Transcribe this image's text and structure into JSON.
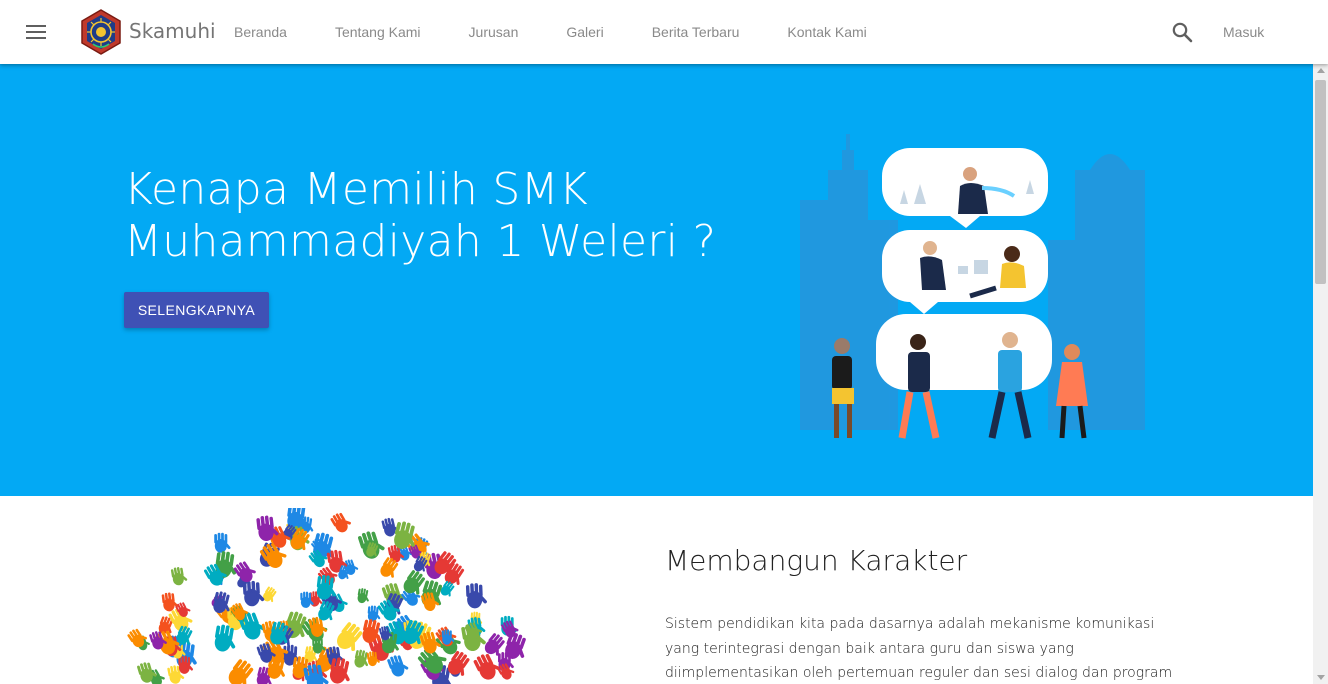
{
  "header": {
    "brand": "Skamuhi",
    "nav": [
      "Beranda",
      "Tentang Kami",
      "Jurusan",
      "Galeri",
      "Berita Terbaru",
      "Kontak Kami"
    ],
    "login_label": "Masuk",
    "icons": {
      "menu": "menu-icon",
      "search": "search-icon",
      "logo": "school-logo"
    }
  },
  "hero": {
    "title_line1": "Kenapa Memilih SMK",
    "title_line2": "Muhammadiyah 1 Weleri ?",
    "button_label": "SELENGKAPNYA"
  },
  "feature": {
    "title": "Membangun Karakter",
    "text": "Sistem pendidikan kita pada dasarnya adalah mekanisme komunikasi yang terintegrasi dengan baik antara guru dan siswa yang diimplementasikan oleh pertemuan reguler dan sesi dialog dan program"
  },
  "colors": {
    "hero_bg": "#03a9f4",
    "button_bg": "#3f51b5",
    "appbar_bg": "#ffffff",
    "nav_text": "#8a8a8a"
  }
}
